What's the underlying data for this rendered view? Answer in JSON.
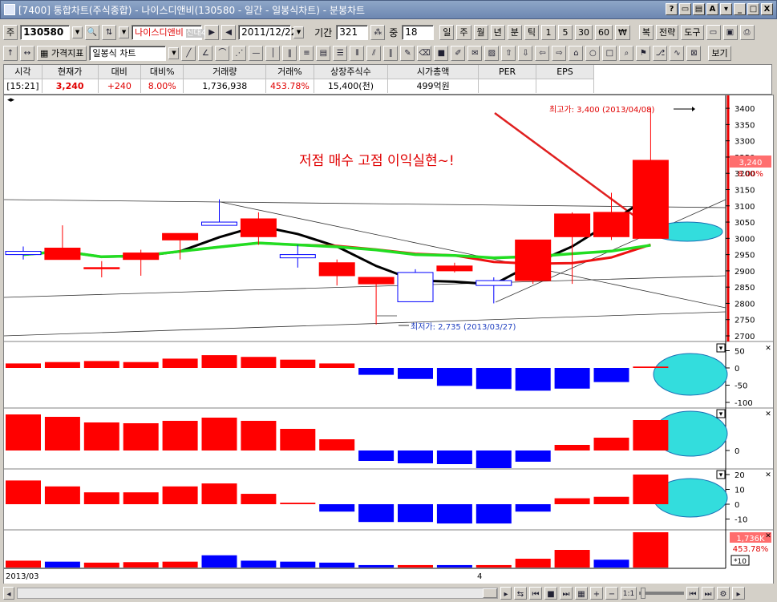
{
  "window": {
    "title": "[7400] 통합차트(주식종합) - 나이스디앤비(130580 - 일간 - 일봉식차트) - 분봉차트",
    "buttons": [
      "?",
      "▭",
      "▤",
      "A",
      "▾",
      "_",
      "□",
      "X"
    ]
  },
  "toolbar1": {
    "market": "주",
    "code": "130580",
    "stock_name": "나이스디앤비",
    "credit_badge": "신대40",
    "date": "2011/12/22",
    "period_label": "기간",
    "period_value": "321",
    "overlap_label": "중",
    "overlap_value": "18",
    "period_buttons": [
      "일",
      "주",
      "월",
      "년",
      "분",
      "틱",
      "1",
      "5",
      "30",
      "60",
      "₩"
    ],
    "right_buttons": [
      "복",
      "전략",
      "도구"
    ]
  },
  "toolbar2": {
    "indicator_label": "가격지표",
    "chart_type": "일봉식 차트",
    "view_label": "보기"
  },
  "quote": {
    "headers": [
      "시각",
      "현재가",
      "대비",
      "대비%",
      "거래량",
      "거래%",
      "상장주식수",
      "시가총액",
      "PER",
      "EPS"
    ],
    "values": [
      "[15:21]",
      "3,240",
      "+240",
      "8.00%",
      "1,736,938",
      "453.78%",
      "15,400(천)",
      "499억원",
      "",
      ""
    ]
  },
  "chart": {
    "annotation": "저점 매수 고점 이익실현~!",
    "high_label": "최고가: 3,400 (2013/04/08)",
    "low_label": "최저가: 2,735 (2013/03/27)",
    "price_badge": "3,240",
    "pct_badge": "8.00%",
    "vol_badge": "1,736K",
    "vol_pct_badge": "453.78%",
    "vol_scale_note": "*10",
    "x_labels": [
      "2013/03",
      "4"
    ],
    "price_ticks": [
      "3400",
      "3350",
      "3300",
      "3250",
      "3200",
      "3150",
      "3100",
      "3050",
      "3000",
      "2950",
      "2900",
      "2850",
      "2800",
      "2750",
      "2700"
    ],
    "osc1_ticks": [
      "50",
      "0",
      "-50",
      "-100"
    ],
    "osc2_ticks": [
      "0"
    ],
    "osc3_ticks": [
      "20",
      "10",
      "0",
      "-10"
    ],
    "colors": {
      "up": "#ff0000",
      "down": "#0000ff",
      "ma_short": "#000000",
      "ma_mid": "#ee1111",
      "ma_long": "#22dd22",
      "highlight": "#33dddd"
    }
  },
  "chart_data": {
    "type": "candlestick",
    "x": [
      "1",
      "2",
      "3",
      "4",
      "5",
      "6",
      "7",
      "8",
      "9",
      "10",
      "11",
      "12",
      "13",
      "14",
      "15",
      "16",
      "17"
    ],
    "candles": [
      {
        "open": 2960,
        "close": 2950,
        "high": 2975,
        "low": 2935
      },
      {
        "open": 2935,
        "close": 2970,
        "high": 3040,
        "low": 2935
      },
      {
        "open": 2910,
        "close": 2910,
        "high": 2930,
        "low": 2880
      },
      {
        "open": 2935,
        "close": 2955,
        "high": 2965,
        "low": 2885
      },
      {
        "open": 2995,
        "close": 3015,
        "high": 3015,
        "low": 2935
      },
      {
        "open": 3050,
        "close": 3040,
        "high": 3120,
        "low": 3040
      },
      {
        "open": 3005,
        "close": 3060,
        "high": 3080,
        "low": 2980
      },
      {
        "open": 2950,
        "close": 2940,
        "high": 2980,
        "low": 2910
      },
      {
        "open": 2885,
        "close": 2925,
        "high": 2935,
        "low": 2855
      },
      {
        "open": 2860,
        "close": 2880,
        "high": 2880,
        "low": 2735
      },
      {
        "open": 2895,
        "close": 2805,
        "high": 2905,
        "low": 2805
      },
      {
        "open": 2900,
        "close": 2915,
        "high": 2925,
        "low": 2895
      },
      {
        "open": 2870,
        "close": 2855,
        "high": 2880,
        "low": 2800
      },
      {
        "open": 2870,
        "close": 2995,
        "high": 2995,
        "low": 2860
      },
      {
        "open": 3005,
        "close": 3075,
        "high": 3080,
        "low": 2860
      },
      {
        "open": 3005,
        "close": 3080,
        "high": 3140,
        "low": 2995
      },
      {
        "open": 3000,
        "close": 3240,
        "high": 3400,
        "low": 3000
      }
    ],
    "osc1": [
      13,
      17,
      20,
      17,
      27,
      37,
      32,
      24,
      13,
      -20,
      -32,
      -52,
      -61,
      -66,
      -60,
      -41,
      4
    ],
    "osc2": [
      45,
      42,
      35,
      34,
      37,
      41,
      37,
      27,
      14,
      -13,
      -16,
      -17,
      -22,
      -14,
      7,
      16,
      38
    ],
    "osc3": [
      16,
      12,
      8,
      8,
      12,
      14,
      7,
      1,
      -5,
      -12,
      -12,
      -13,
      -13,
      -5,
      4,
      5,
      20
    ],
    "volume": [
      140,
      120,
      100,
      110,
      120,
      250,
      140,
      120,
      100,
      50,
      50,
      50,
      50,
      180,
      360,
      160,
      720
    ],
    "volume_up": [
      true,
      false,
      true,
      true,
      true,
      false,
      false,
      false,
      false,
      false,
      true,
      false,
      true,
      true,
      true,
      false,
      true
    ],
    "ylim": [
      2700,
      3420
    ]
  }
}
